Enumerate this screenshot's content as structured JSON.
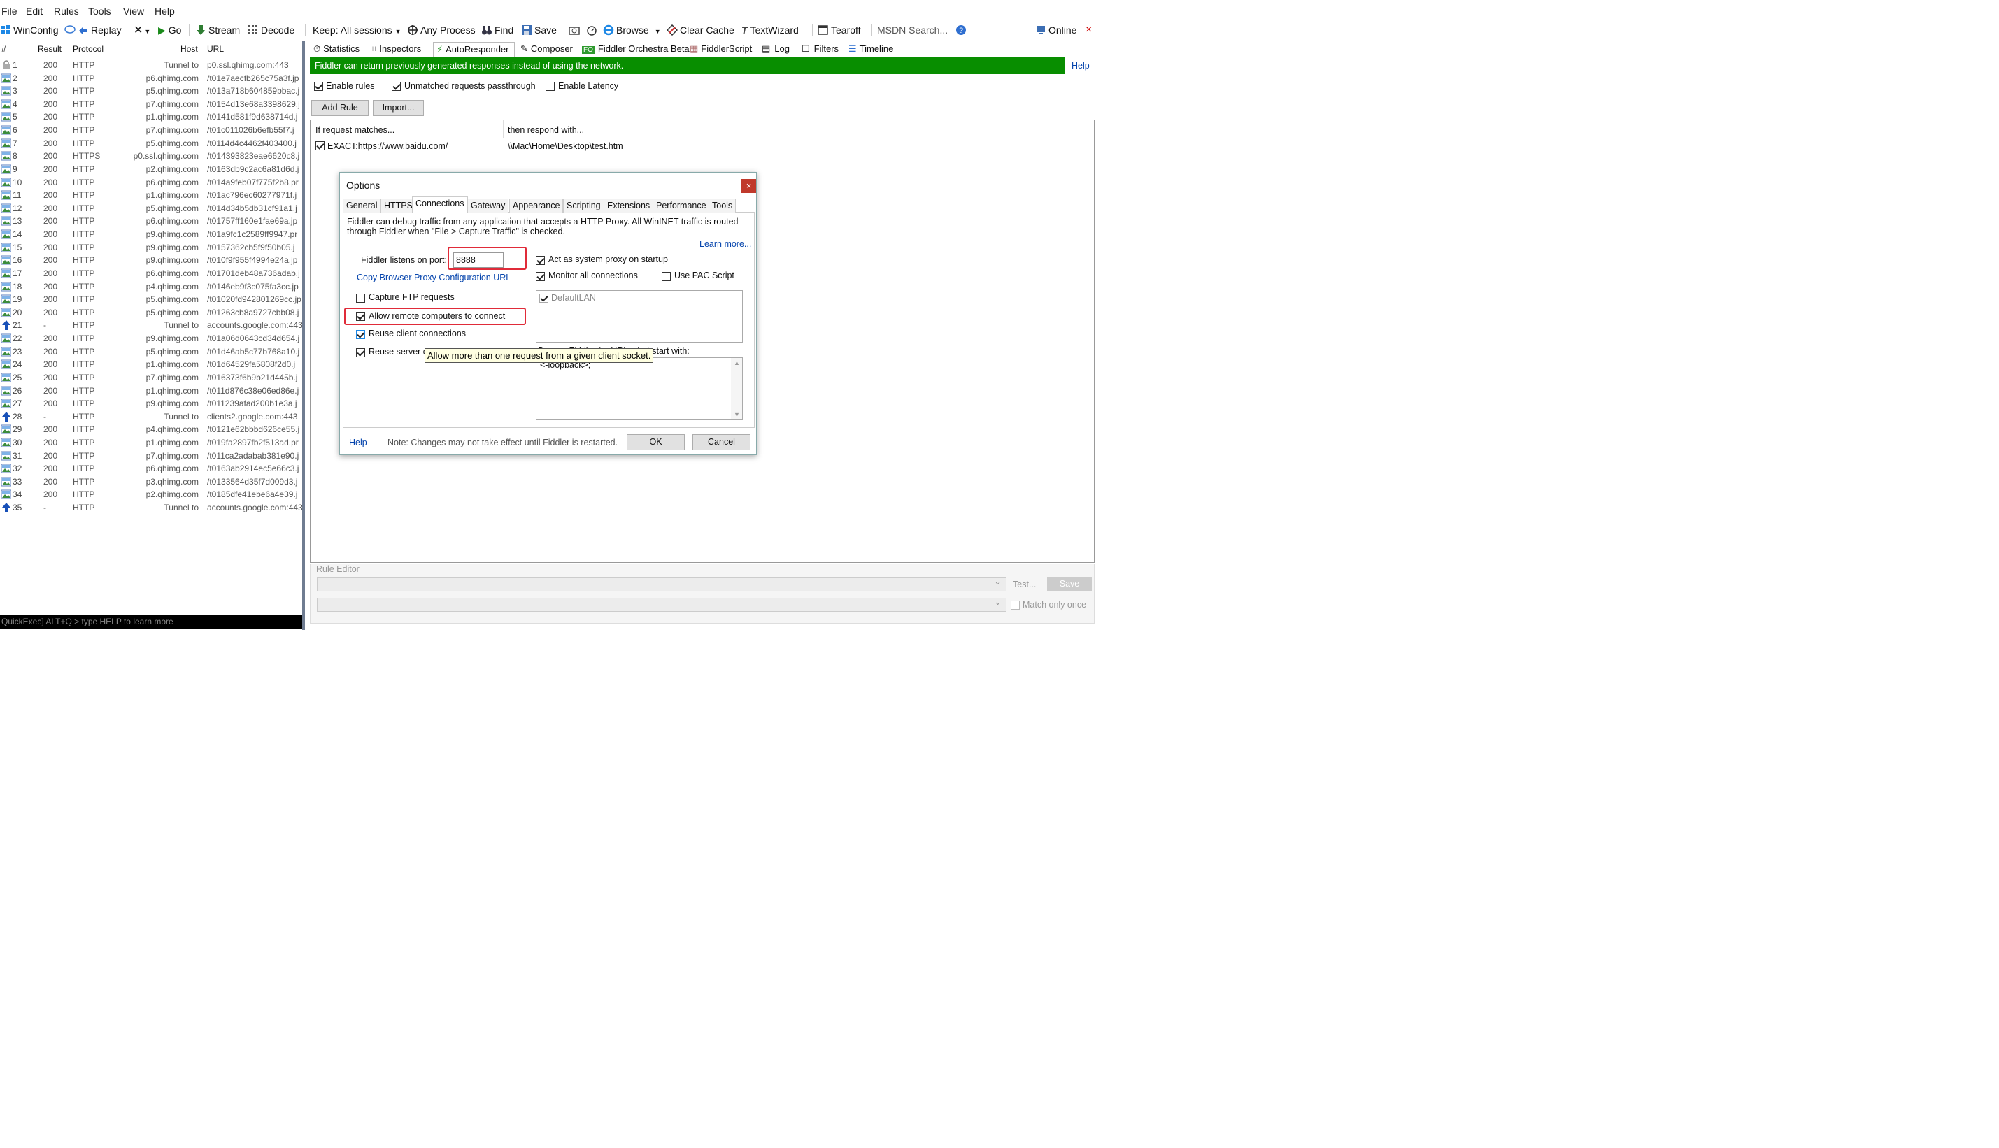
{
  "menu": [
    "File",
    "Edit",
    "Rules",
    "Tools",
    "View",
    "Help"
  ],
  "toolbar": {
    "winconfig": "WinConfig",
    "replay": "Replay",
    "go": "Go",
    "stream": "Stream",
    "decode": "Decode",
    "keep": "Keep: All sessions",
    "any_process": "Any Process",
    "find": "Find",
    "save": "Save",
    "browse": "Browse",
    "clear_cache": "Clear Cache",
    "textwizard": "TextWizard",
    "tearoff": "Tearoff",
    "msdn_search": "MSDN Search...",
    "online": "Online",
    "close": "×"
  },
  "sessions": {
    "columns": {
      "num": "#",
      "result": "Result",
      "protocol": "Protocol",
      "host": "Host",
      "url": "URL"
    },
    "rows": [
      {
        "num": "1",
        "result": "200",
        "protocol": "HTTP",
        "host": "Tunnel to",
        "url": "p0.ssl.qhimg.com:443",
        "icon": "lock"
      },
      {
        "num": "2",
        "result": "200",
        "protocol": "HTTP",
        "host": "p6.qhimg.com",
        "url": "/t01e7aecfb265c75a3f.jp",
        "icon": "image"
      },
      {
        "num": "3",
        "result": "200",
        "protocol": "HTTP",
        "host": "p5.qhimg.com",
        "url": "/t013a718b604859bbac.j",
        "icon": "image"
      },
      {
        "num": "4",
        "result": "200",
        "protocol": "HTTP",
        "host": "p7.qhimg.com",
        "url": "/t0154d13e68a3398629.j",
        "icon": "image"
      },
      {
        "num": "5",
        "result": "200",
        "protocol": "HTTP",
        "host": "p1.qhimg.com",
        "url": "/t0141d581f9d638714d.j",
        "icon": "image"
      },
      {
        "num": "6",
        "result": "200",
        "protocol": "HTTP",
        "host": "p7.qhimg.com",
        "url": "/t01c011026b6efb55f7.j",
        "icon": "image"
      },
      {
        "num": "7",
        "result": "200",
        "protocol": "HTTP",
        "host": "p5.qhimg.com",
        "url": "/t0114d4c4462f403400.j",
        "icon": "image"
      },
      {
        "num": "8",
        "result": "200",
        "protocol": "HTTPS",
        "host": "p0.ssl.qhimg.com",
        "url": "/t014393823eae6620c8.j",
        "icon": "image"
      },
      {
        "num": "9",
        "result": "200",
        "protocol": "HTTP",
        "host": "p2.qhimg.com",
        "url": "/t0163db9c2ac6a81d6d.j",
        "icon": "image"
      },
      {
        "num": "10",
        "result": "200",
        "protocol": "HTTP",
        "host": "p6.qhimg.com",
        "url": "/t014a9feb07f775f2b8.pr",
        "icon": "image"
      },
      {
        "num": "11",
        "result": "200",
        "protocol": "HTTP",
        "host": "p1.qhimg.com",
        "url": "/t01ac796ec60277971f.j",
        "icon": "image"
      },
      {
        "num": "12",
        "result": "200",
        "protocol": "HTTP",
        "host": "p5.qhimg.com",
        "url": "/t014d34b5db31cf91a1.j",
        "icon": "image"
      },
      {
        "num": "13",
        "result": "200",
        "protocol": "HTTP",
        "host": "p6.qhimg.com",
        "url": "/t01757ff160e1fae69a.jp",
        "icon": "image"
      },
      {
        "num": "14",
        "result": "200",
        "protocol": "HTTP",
        "host": "p9.qhimg.com",
        "url": "/t01a9fc1c2589ff9947.pr",
        "icon": "image"
      },
      {
        "num": "15",
        "result": "200",
        "protocol": "HTTP",
        "host": "p9.qhimg.com",
        "url": "/t0157362cb5f9f50b05.j",
        "icon": "image"
      },
      {
        "num": "16",
        "result": "200",
        "protocol": "HTTP",
        "host": "p9.qhimg.com",
        "url": "/t010f9f955f4994e24a.jp",
        "icon": "image"
      },
      {
        "num": "17",
        "result": "200",
        "protocol": "HTTP",
        "host": "p6.qhimg.com",
        "url": "/t01701deb48a736adab.j",
        "icon": "image"
      },
      {
        "num": "18",
        "result": "200",
        "protocol": "HTTP",
        "host": "p4.qhimg.com",
        "url": "/t0146eb9f3c075fa3cc.jp",
        "icon": "image"
      },
      {
        "num": "19",
        "result": "200",
        "protocol": "HTTP",
        "host": "p5.qhimg.com",
        "url": "/t01020fd942801269cc.jp",
        "icon": "image"
      },
      {
        "num": "20",
        "result": "200",
        "protocol": "HTTP",
        "host": "p5.qhimg.com",
        "url": "/t01263cb8a9727cbb08.j",
        "icon": "image"
      },
      {
        "num": "21",
        "result": "-",
        "protocol": "HTTP",
        "host": "Tunnel to",
        "url": "accounts.google.com:443",
        "icon": "arrow"
      },
      {
        "num": "22",
        "result": "200",
        "protocol": "HTTP",
        "host": "p9.qhimg.com",
        "url": "/t01a06d0643cd34d654.j",
        "icon": "image"
      },
      {
        "num": "23",
        "result": "200",
        "protocol": "HTTP",
        "host": "p5.qhimg.com",
        "url": "/t01d46ab5c77b768a10.j",
        "icon": "image"
      },
      {
        "num": "24",
        "result": "200",
        "protocol": "HTTP",
        "host": "p1.qhimg.com",
        "url": "/t01d64529fa5808f2d0.j",
        "icon": "image"
      },
      {
        "num": "25",
        "result": "200",
        "protocol": "HTTP",
        "host": "p7.qhimg.com",
        "url": "/t016373f6b9b21d445b.j",
        "icon": "image"
      },
      {
        "num": "26",
        "result": "200",
        "protocol": "HTTP",
        "host": "p1.qhimg.com",
        "url": "/t011d876c38e06ed86e.j",
        "icon": "image"
      },
      {
        "num": "27",
        "result": "200",
        "protocol": "HTTP",
        "host": "p9.qhimg.com",
        "url": "/t011239afad200b1e3a.j",
        "icon": "image"
      },
      {
        "num": "28",
        "result": "-",
        "protocol": "HTTP",
        "host": "Tunnel to",
        "url": "clients2.google.com:443",
        "icon": "arrow"
      },
      {
        "num": "29",
        "result": "200",
        "protocol": "HTTP",
        "host": "p4.qhimg.com",
        "url": "/t0121e62bbbd626ce55.j",
        "icon": "image"
      },
      {
        "num": "30",
        "result": "200",
        "protocol": "HTTP",
        "host": "p1.qhimg.com",
        "url": "/t019fa2897fb2f513ad.pr",
        "icon": "image"
      },
      {
        "num": "31",
        "result": "200",
        "protocol": "HTTP",
        "host": "p7.qhimg.com",
        "url": "/t011ca2adabab381e90.j",
        "icon": "image"
      },
      {
        "num": "32",
        "result": "200",
        "protocol": "HTTP",
        "host": "p6.qhimg.com",
        "url": "/t0163ab2914ec5e66c3.j",
        "icon": "image"
      },
      {
        "num": "33",
        "result": "200",
        "protocol": "HTTP",
        "host": "p3.qhimg.com",
        "url": "/t0133564d35f7d009d3.j",
        "icon": "image"
      },
      {
        "num": "34",
        "result": "200",
        "protocol": "HTTP",
        "host": "p2.qhimg.com",
        "url": "/t0185dfe41ebe6a4e39.j",
        "icon": "image"
      },
      {
        "num": "35",
        "result": "-",
        "protocol": "HTTP",
        "host": "Tunnel to",
        "url": "accounts.google.com:443",
        "icon": "arrow"
      }
    ]
  },
  "quickexec": "QuickExec] ALT+Q > type HELP to learn more",
  "tabs": [
    "Statistics",
    "Inspectors",
    "AutoResponder",
    "Composer",
    "Fiddler Orchestra Beta",
    "FiddlerScript",
    "Log",
    "Filters",
    "Timeline"
  ],
  "fo_badge": "FO",
  "autoresponder": {
    "banner": "Fiddler can return previously generated responses instead of using the network.",
    "help": "Help",
    "enable_rules": "Enable rules",
    "unmatched": "Unmatched requests passthrough",
    "enable_latency": "Enable Latency",
    "add_rule": "Add Rule",
    "import": "Import...",
    "col_match": "If request matches...",
    "col_respond": "then respond with...",
    "rule_match": "EXACT:https://www.baidu.com/",
    "rule_respond": "\\\\Mac\\Home\\Desktop\\test.htm",
    "rule_editor": "Rule Editor",
    "test": "Test...",
    "save": "Save",
    "match_once": "Match only once"
  },
  "dialog": {
    "title": "Options",
    "close": "×",
    "tabs": [
      "General",
      "HTTPS",
      "Connections",
      "Gateway",
      "Appearance",
      "Scripting",
      "Extensions",
      "Performance",
      "Tools"
    ],
    "active_tab": "Connections",
    "description": "Fiddler can debug traffic from any application that accepts a HTTP Proxy. All WinINET traffic is routed through Fiddler when \"File > Capture Traffic\" is checked.",
    "learn_more": "Learn more...",
    "port_label": "Fiddler listens on port:",
    "port_value": "8888",
    "copy_pac": "Copy Browser Proxy Configuration URL",
    "capture_ftp": "Capture FTP requests",
    "allow_remote": "Allow remote computers to connect",
    "reuse_client": "Reuse client connections",
    "reuse_server": "Reuse server c",
    "act_as_proxy": "Act as system proxy on startup",
    "monitor_all": "Monitor all connections",
    "use_pac": "Use PAC Script",
    "lan_item": "DefaultLAN",
    "bypass_label": "Bypass Fiddler for URLs that start with:",
    "bypass_value": "<-loopback>;",
    "tooltip": "Allow more than one request from a given client socket.",
    "help": "Help",
    "note": "Note: Changes may not take effect until Fiddler is restarted.",
    "ok": "OK",
    "cancel": "Cancel"
  },
  "colors": {
    "banner": "#088e00",
    "highlight": "#e02b39",
    "link": "#0645ad",
    "tooltip_bg": "#ffffe1"
  }
}
